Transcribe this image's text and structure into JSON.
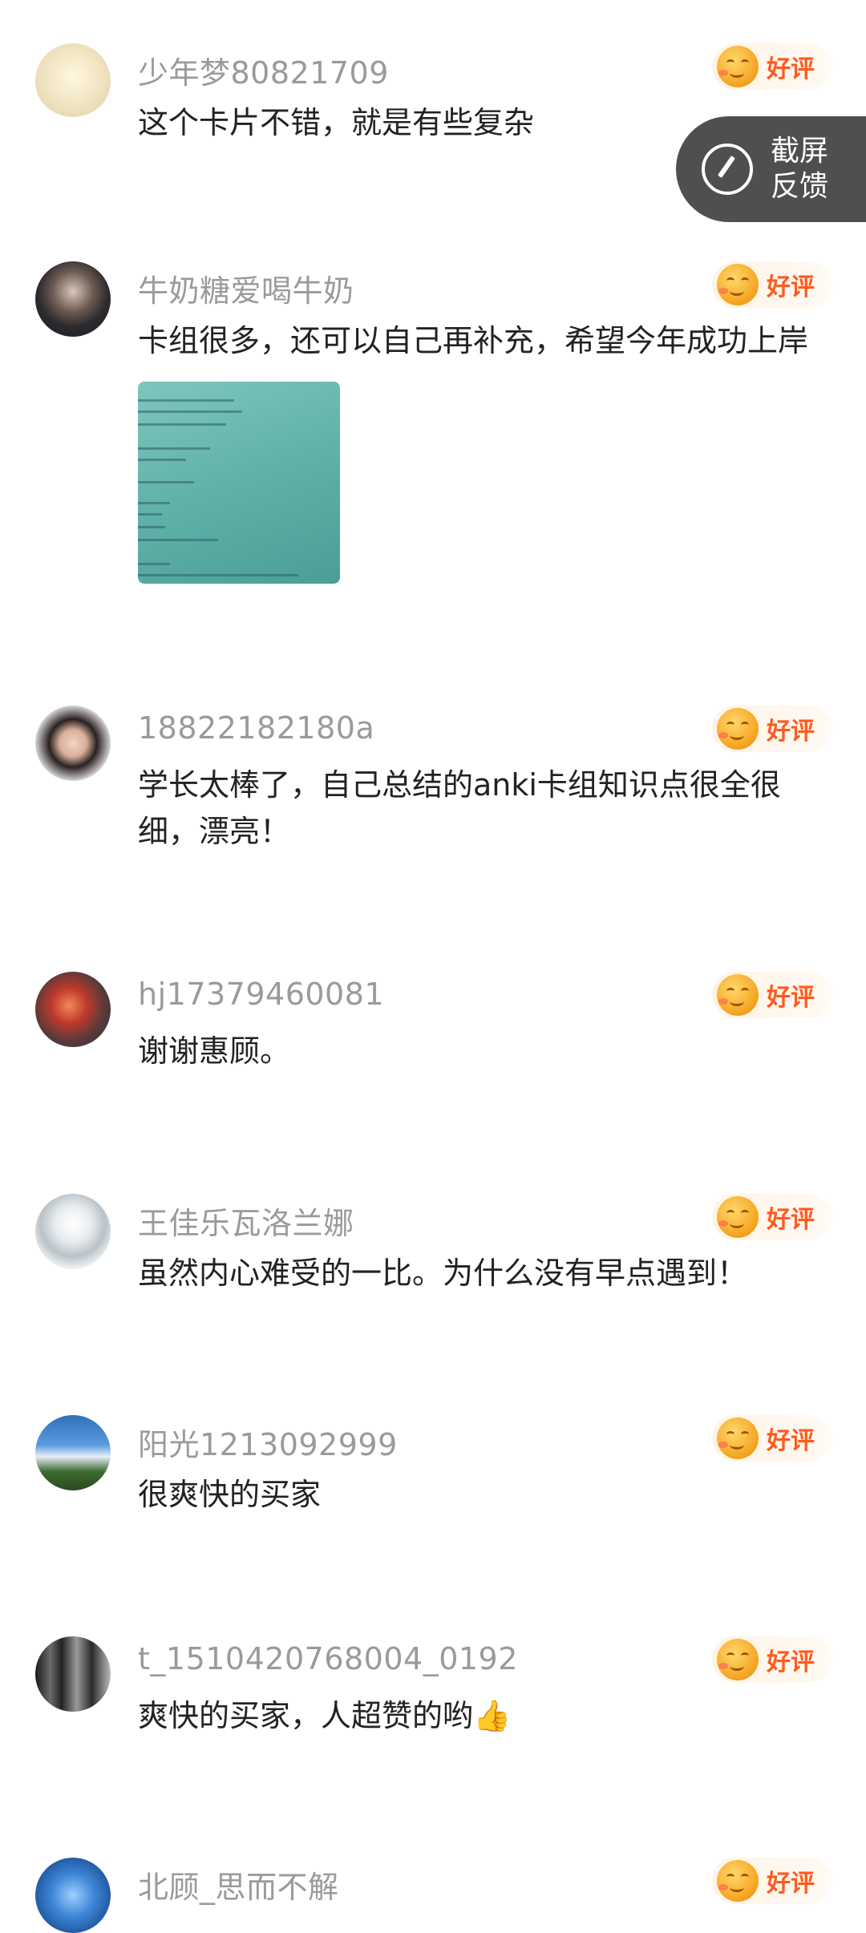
{
  "rating_label": "好评",
  "feedback_button": {
    "line1": "截屏",
    "line2": "反馈"
  },
  "comments": [
    {
      "username": "少年梦80821709",
      "text": "这个卡片不错，就是有些复杂"
    },
    {
      "username": "牛奶糖爱喝牛奶",
      "text": "卡组很多，还可以自己再补充，希望今年成功上岸"
    },
    {
      "username": "18822182180a",
      "text": "学长太棒了，自己总结的anki卡组知识点很全很细，漂亮！"
    },
    {
      "username": "hj17379460081",
      "text": "谢谢惠顾。"
    },
    {
      "username": "王佳乐瓦洛兰娜",
      "text": "虽然内心难受的一比。为什么没有早点遇到！"
    },
    {
      "username": "阳光1213092999",
      "text": "很爽快的买家"
    },
    {
      "username": "t_1510420768004_0192",
      "text": "爽快的买家，人超赞的哟",
      "emoji": "👍"
    },
    {
      "username": "北顾_思而不解",
      "text": ""
    }
  ],
  "colors": {
    "username": "#9a9a9a",
    "text": "#222222",
    "rating_accent": "#ff5a1f",
    "feedback_bg": "#4f4f4f"
  }
}
